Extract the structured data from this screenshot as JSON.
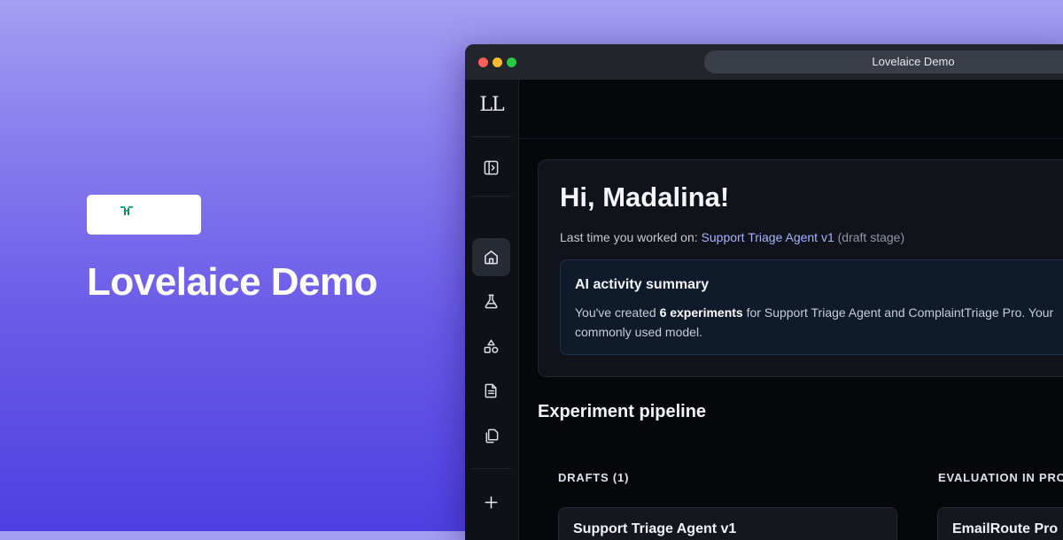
{
  "hero": {
    "title": "Lovelaice Demo"
  },
  "window": {
    "url_title": "Lovelaice Demo"
  },
  "sidebar": {
    "logo": "LL",
    "items": [
      {
        "icon": "panel-toggle-icon"
      },
      {
        "icon": "home-icon",
        "active": true
      },
      {
        "icon": "flask-icon"
      },
      {
        "icon": "shapes-icon"
      },
      {
        "icon": "document-icon"
      },
      {
        "icon": "copy-icon"
      },
      {
        "icon": "plus-icon"
      }
    ]
  },
  "welcome": {
    "greeting": "Hi, Madalina!",
    "last_prefix": "Last time you worked on: ",
    "last_project": "Support Triage Agent v1",
    "last_stage": " (draft stage)"
  },
  "ai_summary": {
    "title": "AI activity summary",
    "line1_prefix": "You've created ",
    "line1_bold": "6 experiments",
    "line1_suffix": " for Support Triage Agent and ComplaintTriage Pro. Your",
    "line2": "commonly used model."
  },
  "pipeline": {
    "title": "Experiment pipeline",
    "columns": [
      {
        "header": "DRAFTS (1)",
        "card_title": "Support Triage Agent v1"
      },
      {
        "header": "EVALUATION IN PROGRESS",
        "card_title": "EmailRoute Pro"
      }
    ]
  },
  "colors": {
    "accent_link": "#a7b3ff",
    "background_gradient_top": "#a59ef2",
    "background_gradient_bottom": "#4f3fe1",
    "logo_green": "#1fae7a"
  }
}
